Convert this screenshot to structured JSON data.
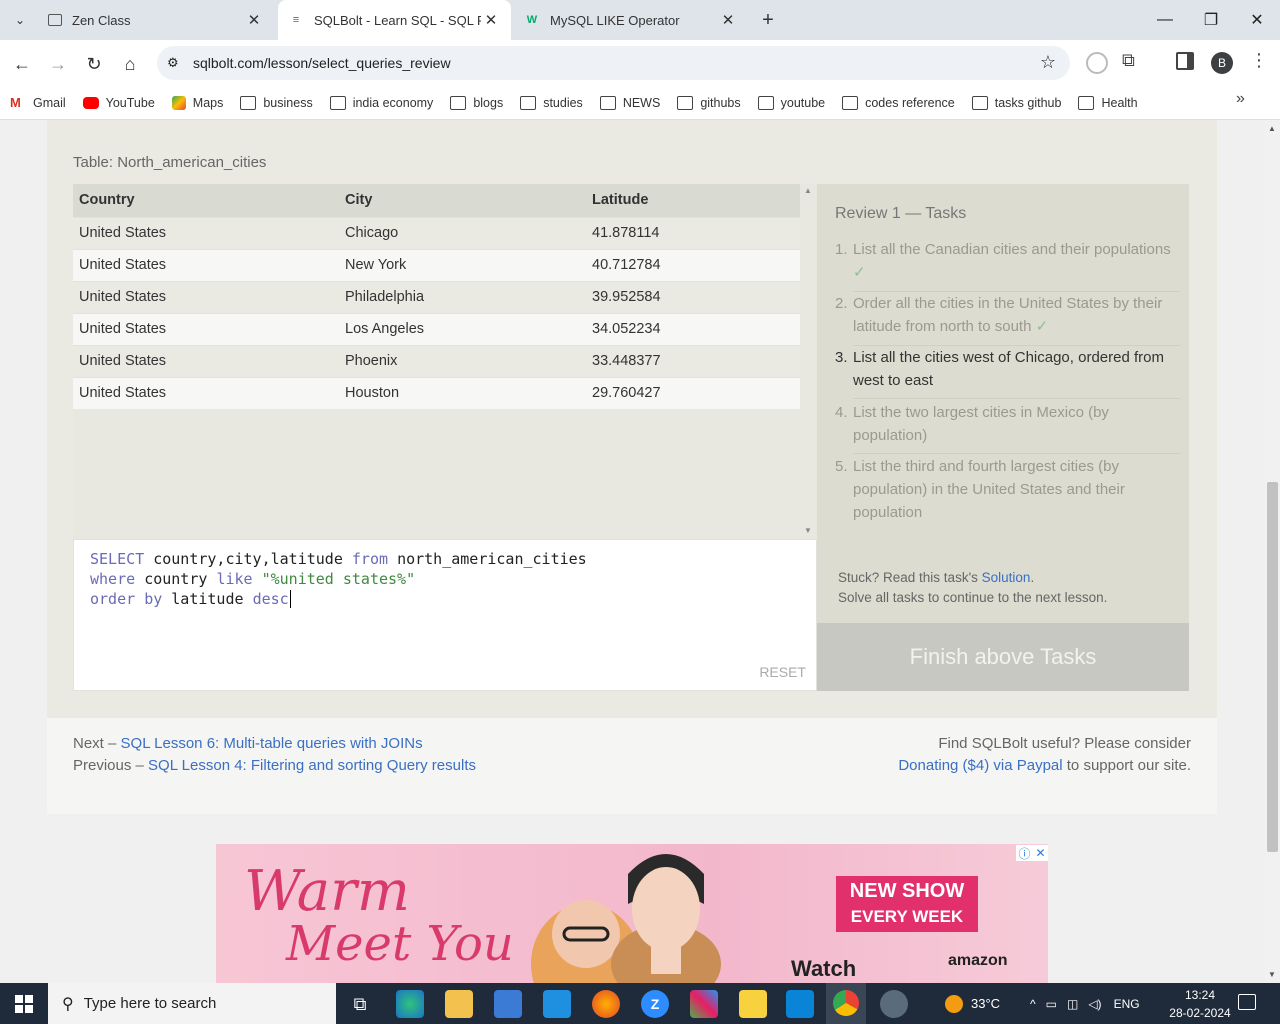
{
  "browser": {
    "tabs": [
      {
        "title": "Zen Class",
        "active": false
      },
      {
        "title": "SQLBolt - Learn SQL - SQL Revi",
        "active": true
      },
      {
        "title": "MySQL LIKE Operator",
        "active": false
      }
    ],
    "url": "sqlbolt.com/lesson/select_queries_review",
    "profile_initial": "B",
    "bookmarks": [
      "Gmail",
      "YouTube",
      "Maps",
      "business",
      "india economy",
      "blogs",
      "studies",
      "NEWS",
      "githubs",
      "youtube",
      "codes reference",
      "tasks github",
      "Health"
    ]
  },
  "lesson": {
    "table_caption": "Table: North_american_cities",
    "table": {
      "columns": [
        "Country",
        "City",
        "Latitude"
      ],
      "rows": [
        [
          "United States",
          "Chicago",
          "41.878114"
        ],
        [
          "United States",
          "New York",
          "40.712784"
        ],
        [
          "United States",
          "Philadelphia",
          "39.952584"
        ],
        [
          "United States",
          "Los Angeles",
          "34.052234"
        ],
        [
          "United States",
          "Phoenix",
          "33.448377"
        ],
        [
          "United States",
          "Houston",
          "29.760427"
        ]
      ]
    },
    "query_lines": [
      "SELECT country,city,latitude from north_american_cities",
      "where country like \"%united states%\"",
      "order by latitude desc"
    ],
    "reset_label": "RESET",
    "tasks_heading": "Review 1 — Tasks",
    "tasks": [
      {
        "num": "1.",
        "text": "List all the Canadian cities and their populations",
        "state": "done",
        "check": "✓"
      },
      {
        "num": "2.",
        "text": "Order all the cities in the United States by their latitude from north to south",
        "state": "done",
        "check": "✓"
      },
      {
        "num": "3.",
        "text": "List all the cities west of Chicago, ordered from west to east",
        "state": "current",
        "check": ""
      },
      {
        "num": "4.",
        "text": "List the two largest cities in Mexico (by population)",
        "state": "todo",
        "check": ""
      },
      {
        "num": "5.",
        "text": "List the third and fourth largest cities (by population) in the United States and their population",
        "state": "todo",
        "check": ""
      }
    ],
    "stuck_prefix": "Stuck? Read this task's ",
    "stuck_link": "Solution",
    "stuck_suffix": ".",
    "stuck_line2": "Solve all tasks to continue to the next lesson.",
    "finish_label": "Finish above Tasks"
  },
  "footer": {
    "next_prefix": "Next – ",
    "next_link": "SQL Lesson 6: Multi-table queries with JOINs",
    "prev_prefix": "Previous – ",
    "prev_link": "SQL Lesson 4: Filtering and sorting Query results",
    "support_line1": "Find SQLBolt useful? Please consider",
    "support_link": "Donating ($4) via Paypal",
    "support_suffix": " to support our site."
  },
  "ad": {
    "headline1": "Warm",
    "headline2": "Meet You",
    "badge_line1": "NEW SHOW",
    "badge_line2": "EVERY WEEK",
    "watch": "Watch",
    "brand": "amazon"
  },
  "taskbar": {
    "search_placeholder": "Type here to search",
    "temperature": "33°C",
    "language": "ENG",
    "time": "13:24",
    "date": "28-02-2024"
  }
}
